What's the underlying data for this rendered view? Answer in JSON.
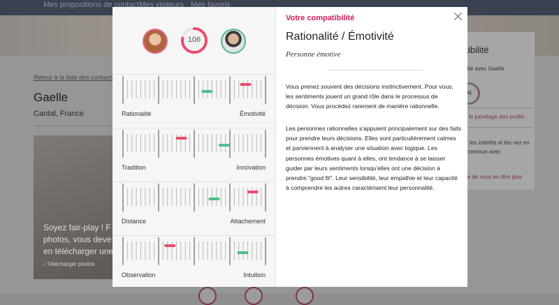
{
  "background": {
    "nav": [
      "Mes propositions de contact",
      "Mes visiteurs",
      "Mes favoris"
    ],
    "back_link": "Retour à la liste des contacts",
    "profile_name": "Gaelle",
    "profile_location": "Cantal, France",
    "photo_text": "Soyez fair-play ! F photos, vous deve en télécharger une",
    "photo_link": "› Télécharger photos",
    "side_card": {
      "heading": "atibilité",
      "subtext": "ibilité avec Gaelle",
      "score": "106",
      "link1": "le jumelage des profils",
      "text": "r les intérêts et les vez en commun avec",
      "link2": "le de vous en dire plus"
    }
  },
  "modal": {
    "score": "106",
    "score_fraction": 0.78,
    "colors": {
      "female": "#e94b6f",
      "male": "#4fbf86",
      "accent": "#d21d5c"
    },
    "traits": [
      {
        "left": "Rationalité",
        "right": "Émotivité",
        "female": 0.86,
        "male": 0.59
      },
      {
        "left": "Tradition",
        "right": "Innovation",
        "female": 0.41,
        "male": 0.71
      },
      {
        "left": "Distance",
        "right": "Attachement",
        "female": 0.91,
        "male": 0.64
      },
      {
        "left": "Observation",
        "right": "Intuition",
        "female": 0.33,
        "male": 0.84
      }
    ],
    "eyebrow": "Votre compatibilité",
    "title": "Rationalité / Émotivité",
    "subtitle": "Personne émotive",
    "paragraph1": "Vous prenez souvent des décisions instinctivement. Pour vous, les sentiments jouent un grand rôle dans le processus de décision. Vous procédez rarement de manière rationnelle.",
    "paragraph2": "Les personnes rationnelles s'appuient principalement sur des faits pour prendre leurs décisions. Elles sont particulièrement calmes et parviennent à analyser une situation avec logique. Les personnes émotives quant à elles, ont tendance à se laisser guider par leurs sentiments lorsqu'elles ont une décision à prendre.\"good fit\". Leur sensibilité, leur empathie et leur capacité à comprendre les autres caractérisent leur personnalité."
  }
}
